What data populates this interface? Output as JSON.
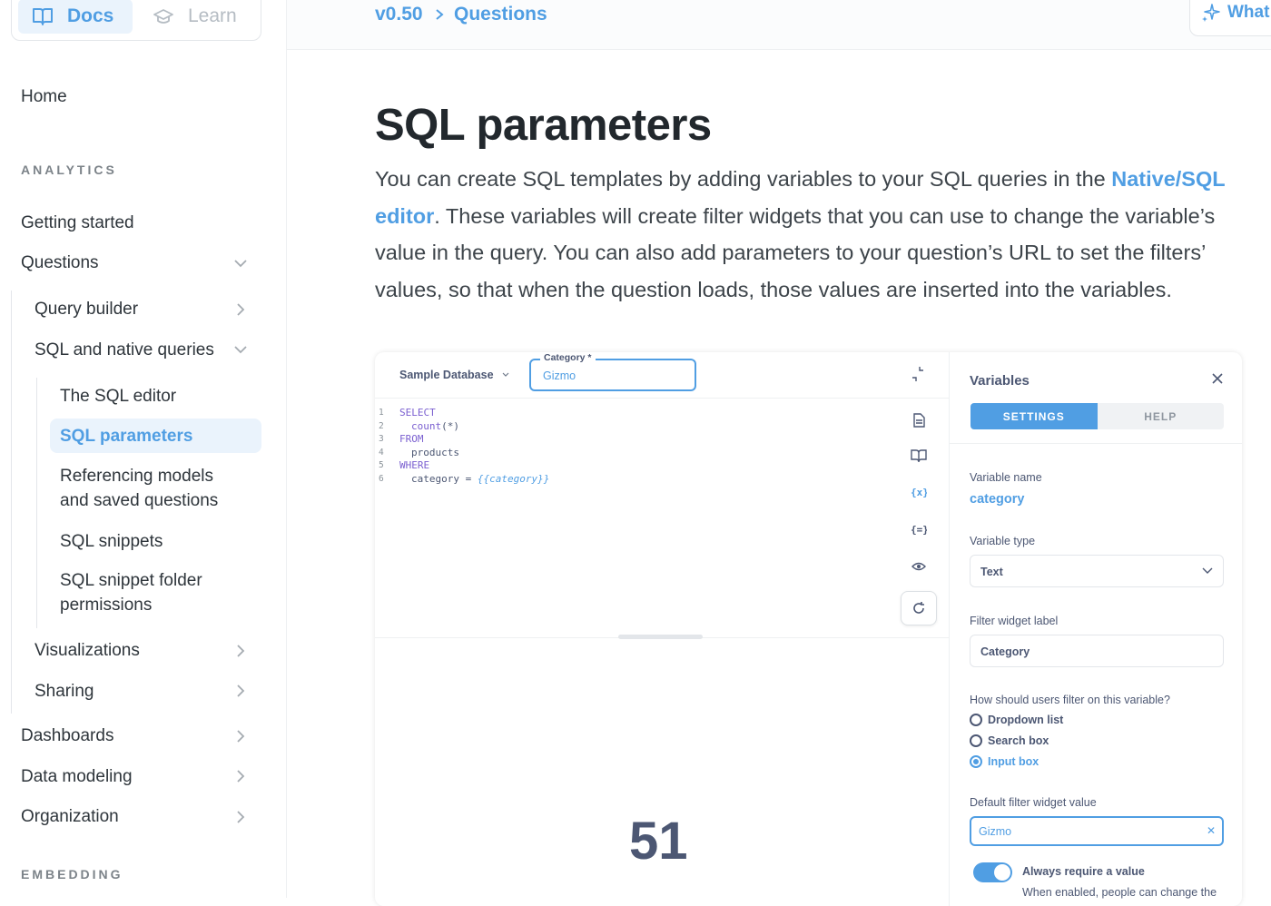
{
  "sidebar": {
    "toggle": {
      "docs_label": "Docs",
      "learn_label": "Learn"
    },
    "home": "Home",
    "analytics_heading": "ANALYTICS",
    "embedding_heading": "EMBEDDING",
    "items": {
      "getting_started": "Getting started",
      "questions": "Questions",
      "query_builder": "Query builder",
      "sql_native": "SQL and native queries",
      "sql_editor": "The SQL editor",
      "sql_parameters": "SQL parameters",
      "referencing_1": "Referencing models",
      "referencing_2": "and saved questions",
      "sql_snippets": "SQL snippets",
      "snippet_folder_1": "SQL snippet folder",
      "snippet_folder_2": "permissions",
      "visualizations": "Visualizations",
      "sharing": "Sharing",
      "dashboards": "Dashboards",
      "data_modeling": "Data modeling",
      "organization": "Organization"
    }
  },
  "topbar": {
    "version": "v0.50",
    "section": "Questions",
    "whats_new_label": "What"
  },
  "article": {
    "title": "SQL parameters",
    "intro_before_link": "You can create SQL templates by adding variables to your SQL queries in the ",
    "intro_link": "Native/SQL editor",
    "intro_after_link": ". These variables will create filter widgets that you can use to change the variable’s value in the query. You can also add parameters to your question’s URL to set the filters’ values, so that when the question loads, those values are inserted into the variables."
  },
  "editor": {
    "database": "Sample Database",
    "filter_label": "Category *",
    "filter_value": "Gizmo",
    "code": {
      "l1_kw": "SELECT",
      "l2_fn": "count",
      "l2_rest": "(*)",
      "l3_kw": "FROM",
      "l4": "products",
      "l5_kw": "WHERE",
      "l6_a": "category = ",
      "l6_var": "{{category}}"
    },
    "line_numbers": [
      "1",
      "2",
      "3",
      "4",
      "5",
      "6"
    ],
    "result": "51"
  },
  "variables_panel": {
    "title": "Variables",
    "tab_settings": "SETTINGS",
    "tab_help": "HELP",
    "variable_name_label": "Variable name",
    "variable_name": "category",
    "variable_type_label": "Variable type",
    "variable_type": "Text",
    "widget_label_label": "Filter widget label",
    "widget_label": "Category",
    "filter_how_label": "How should users filter on this variable?",
    "radio_options": [
      "Dropdown list",
      "Search box",
      "Input box"
    ],
    "selected_option": "Input box",
    "default_value_label": "Default filter widget value",
    "default_value": "Gizmo",
    "always_require_label": "Always require a value",
    "always_require_on": true,
    "always_require_help": "When enabled, people can change the"
  },
  "colors": {
    "brand": "#509ee3",
    "text_dark": "#2e353b",
    "text_muted": "#7c8389"
  }
}
